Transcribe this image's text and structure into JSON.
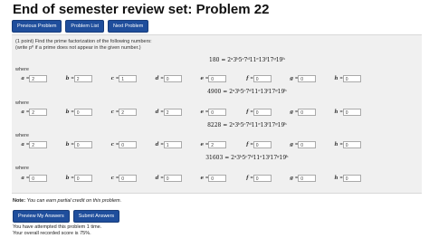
{
  "title": "End of semester review set: Problem 22",
  "nav": {
    "previous": "Previous Problem",
    "list": "Problem List",
    "next": "Next Problem"
  },
  "intro": {
    "line1": "(1 point) Find the prime factorization of the following numbers:",
    "line2": "(write p⁰ if a prime does not appear in the given number.)"
  },
  "where_label": "where",
  "problems": [
    {
      "equation": "180 = 2ᵃ3ᵇ5ᶜ7ᵈ11ᵉ13ᶠ17ᵍ19ʰ",
      "vars": [
        {
          "name": "a",
          "value": "2"
        },
        {
          "name": "b",
          "value": "2"
        },
        {
          "name": "c",
          "value": "1"
        },
        {
          "name": "d",
          "value": "0"
        },
        {
          "name": "e",
          "value": "0"
        },
        {
          "name": "f",
          "value": "0"
        },
        {
          "name": "g",
          "value": "0"
        },
        {
          "name": "h",
          "value": "0"
        }
      ]
    },
    {
      "equation": "4900 = 2ᵃ3ᵇ5ᶜ7ᵈ11ᵉ13ᶠ17ᵍ19ʰ",
      "vars": [
        {
          "name": "a",
          "value": "2"
        },
        {
          "name": "b",
          "value": "0"
        },
        {
          "name": "c",
          "value": "2"
        },
        {
          "name": "d",
          "value": "2"
        },
        {
          "name": "e",
          "value": "0"
        },
        {
          "name": "f",
          "value": "0"
        },
        {
          "name": "g",
          "value": "0"
        },
        {
          "name": "h",
          "value": "0"
        }
      ]
    },
    {
      "equation": "8228 = 2ᵃ3ᵇ5ᶜ7ᵈ11ᵉ13ᶠ17ᵍ19ʰ",
      "vars": [
        {
          "name": "a",
          "value": "2"
        },
        {
          "name": "b",
          "value": "0"
        },
        {
          "name": "c",
          "value": "0"
        },
        {
          "name": "d",
          "value": "1"
        },
        {
          "name": "e",
          "value": "2"
        },
        {
          "name": "f",
          "value": "0"
        },
        {
          "name": "g",
          "value": "0"
        },
        {
          "name": "h",
          "value": "0"
        }
      ]
    },
    {
      "equation": "31603 = 2ᵃ3ᵇ5ᶜ7ᵈ11ᵉ13ᶠ17ᵍ19ʰ",
      "vars": [
        {
          "name": "a",
          "value": "0"
        },
        {
          "name": "b",
          "value": "0"
        },
        {
          "name": "c",
          "value": "0"
        },
        {
          "name": "d",
          "value": "0"
        },
        {
          "name": "e",
          "value": "0"
        },
        {
          "name": "f",
          "value": "0"
        },
        {
          "name": "g",
          "value": "0"
        },
        {
          "name": "h",
          "value": "0"
        }
      ]
    }
  ],
  "note": {
    "label": "Note:",
    "text": "You can earn partial credit on this problem."
  },
  "actions": {
    "preview": "Preview My Answers",
    "submit": "Submit Answers"
  },
  "status": {
    "attempts": "You have attempted this problem 1 time.",
    "score": "Your overall recorded score is 75%."
  },
  "colors": {
    "button": "#1f4e9c",
    "panel": "#f0f0f0"
  }
}
